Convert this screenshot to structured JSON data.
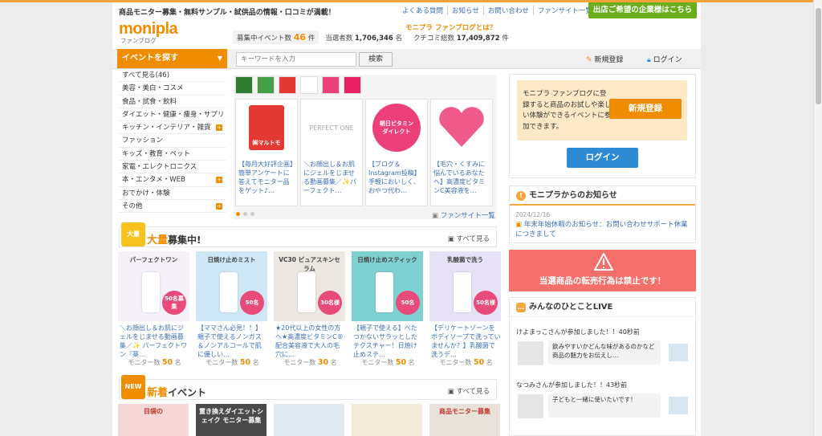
{
  "header": {
    "tagline": "商品モニター募集・無料サンプル・試供品の情報・口コミが満載！",
    "links": [
      "よくある質問",
      "お知らせ",
      "お問い合わせ",
      "ファンサイト一覧"
    ],
    "corp_button": "出店ご希望の企業様はこちら",
    "logo": "monipla",
    "logo_sub": "ファンブログ",
    "about": "モニプラ ファンブログとは？",
    "stat_events_label": "募集中イベント数",
    "stat_events_value": "46",
    "stat_events_unit": "件",
    "stat_members_label": "当選者数",
    "stat_members_value": "1,706,346",
    "stat_members_unit": "名",
    "stat_reviews_label": "クチコミ総数",
    "stat_reviews_value": "17,409,872",
    "stat_reviews_unit": "件"
  },
  "nav": {
    "search_tab": "イベントを探す",
    "search_arrow": "▼",
    "search_placeholder": "キーワードを入力",
    "search_button": "検索",
    "register_link": "新規登録",
    "login_link": "ログイン"
  },
  "categories": [
    {
      "label": "すべて見る(46)",
      "plus": false
    },
    {
      "label": "美容・美白・コスメ",
      "plus": false
    },
    {
      "label": "食品・試食・飲料",
      "plus": false
    },
    {
      "label": "ダイエット・健康・痩身・サプリ",
      "plus": false
    },
    {
      "label": "キッチン・インテリア・雑貨",
      "plus": true
    },
    {
      "label": "ファッション",
      "plus": false
    },
    {
      "label": "キッズ・教育・ペット",
      "plus": false
    },
    {
      "label": "家電・エレクトロニクス",
      "plus": false
    },
    {
      "label": "本・エンタメ・WEB",
      "plus": true
    },
    {
      "label": "おでかけ・体験",
      "plus": false
    },
    {
      "label": "その他",
      "plus": true
    }
  ],
  "carousel": {
    "logo_colors": [
      "#2e7d32",
      "#43a047",
      "#e53935",
      "#ffffff",
      "#ec407a",
      "#e91e63"
    ],
    "items": [
      {
        "text": "【毎月大好評企画】簡単アンケートに答えてモニター品をゲット♪…",
        "img_label": "㈱マルトモ",
        "img_color": "#e53935"
      },
      {
        "text": "＼お顔出し＆お肌にジェルをじませる動画募集／✨パーフェクト…",
        "img_label": "PERFECT ONE",
        "img_color": "#cccccc"
      },
      {
        "text": "【ブログ＆Instagram投稿】手軽においしく、おやつ代わ…",
        "img_label": "朝日ビタミン ダイレクト",
        "img_color": "#ec407a"
      },
      {
        "text": "【毛穴・くすみに悩んでいるあなたへ】高濃度ビタミンC美容液を…",
        "img_label": "",
        "img_color": "#ef5a8a"
      }
    ],
    "fansite_link": "ファンサイト一覧"
  },
  "mass": {
    "badge": "大量",
    "title_em": "大量",
    "title_rest": "募集中!",
    "all_link": "すべて見る",
    "count_label": "モニター数",
    "count_unit": "名",
    "items": [
      {
        "text": "＼お顔出し＆お肌にジェルをじませる動画募集／✨ パーフェクトワン『薬…",
        "count": "50",
        "img_title": "パーフェクトワン",
        "img_badge": "50名募集",
        "bg": "#f6f1f8"
      },
      {
        "text": "【ママさん必見！！】親子で使えるノンガス＆ノンアルコールで肌に優しい…",
        "count": "50",
        "img_title": "日焼け止めミスト",
        "img_badge": "50名",
        "bg": "#cfe7f5"
      },
      {
        "text": "★20代以上の女性の方へ★高濃度ビタミンC®配合美容液で大人の毛穴に…",
        "count": "30",
        "img_title": "VC30 ピュアスキンセラム",
        "img_badge": "30名様",
        "bg": "#ece7e1"
      },
      {
        "text": "【親子で使える】べたつかないサラッとしたテクスチャー！日焼け止めステ…",
        "count": "50",
        "img_title": "日焼け止めスティック",
        "img_badge": "50名",
        "bg": "#7fd0d0"
      },
      {
        "text": "【デリケートゾーンをボディソープで洗っていませんか？】乳酸菌で洗うデ…",
        "count": "50",
        "img_title": "乳酸菌で洗う",
        "img_badge": "50名様",
        "bg": "#e7e1f5"
      }
    ]
  },
  "newest": {
    "badge": "NEW",
    "title_em": "新着",
    "title_rest": "イベント",
    "all_link": "すべて見る",
    "items": [
      {
        "label": "目袋の",
        "bg": "#f5d7d7"
      },
      {
        "label": "置き換えダイエットシェイク モニター募集",
        "bg": "#4a4a4a"
      },
      {
        "label": "",
        "bg": "#dfeaf2"
      },
      {
        "label": "",
        "bg": "#f3ead9"
      },
      {
        "label": "商品モニター募集",
        "bg": "#e8e2db"
      }
    ]
  },
  "sidebar": {
    "reg_text": "モニプラ ファンブログに登録すると商品のお試しや楽しい体験ができるイベントに参加できます。",
    "reg_button": "新規登録",
    "login_button": "ログイン",
    "news_title": "モニプラからのお知らせ",
    "news_icon": "!",
    "news_date": "2024/12/16",
    "news_text": "年末年始休暇のお知らせ：お問い合わせサポート休業につきまして",
    "warning": "当選商品の転売行為は禁止です！",
    "live_title": "みんなのひとことLIVE",
    "live": [
      {
        "who": "けよまっこさんが参加しました！！40秒前",
        "msg": "飲みやすいかどんな味があるのかなど商品の魅力をお伝えし…"
      },
      {
        "who": "なつみさんが参加しました！！43秒前",
        "msg": "子どもと一緒に使いたいです！"
      }
    ]
  }
}
